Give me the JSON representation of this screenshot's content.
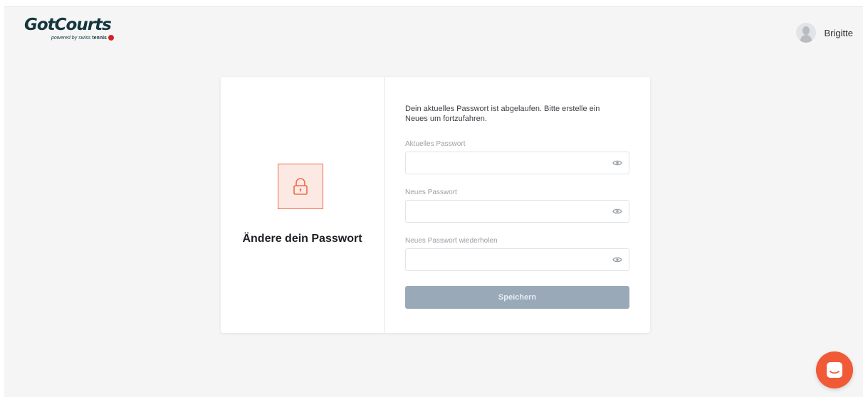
{
  "header": {
    "logo": {
      "word": "GotCourts",
      "powered": "powered by",
      "brand_light": "swiss",
      "brand_bold": "tennis"
    },
    "user": {
      "name": "Brigitte",
      "avatar_icon": "user-avatar-icon"
    }
  },
  "card": {
    "title": "Ändere dein Passwort",
    "lock_icon": "lock-icon",
    "intro": "Dein aktuelles Passwort ist abgelaufen. Bitte erstelle ein Neues um fortzufahren.",
    "fields": [
      {
        "label": "Aktuelles Passwort",
        "value": "",
        "placeholder": "",
        "icon": "eye-icon"
      },
      {
        "label": "Neues Passwort",
        "value": "",
        "placeholder": "",
        "icon": "eye-icon"
      },
      {
        "label": "Neues Passwort wiederholen",
        "value": "",
        "placeholder": "",
        "icon": "eye-icon"
      }
    ],
    "save_label": "Speichern"
  },
  "chat": {
    "icon": "chat-icon"
  },
  "colors": {
    "accent": "#f05a36",
    "lock_bg": "#fde9e3",
    "button_disabled": "#9aa9b7",
    "brand_dark": "#14363c"
  }
}
